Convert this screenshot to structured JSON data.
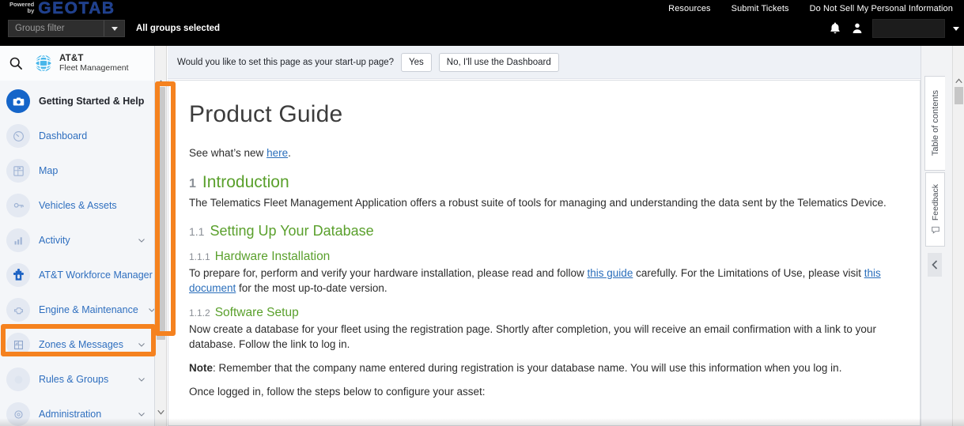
{
  "topbar": {
    "brand_powered": "Powered",
    "brand_by": "by",
    "brand_name": "GEOTAB",
    "groups_filter_placeholder": "Groups filter",
    "groups_selected": "All groups selected",
    "links": [
      {
        "label": "Resources"
      },
      {
        "label": "Submit Tickets"
      },
      {
        "label": "Do Not Sell My Personal Information"
      }
    ],
    "notifications_icon": "bell-icon",
    "user_icon": "person-icon",
    "user_name": "",
    "background_color": "#000000"
  },
  "sidebar": {
    "search_icon": "search-icon",
    "brand_line1": "AT&T",
    "brand_line2": "Fleet Management",
    "items": [
      {
        "label": "Getting Started & Help",
        "icon": "help-camera-icon",
        "expandable": true,
        "current": true,
        "style": "active"
      },
      {
        "label": "Dashboard",
        "icon": "gauge-icon",
        "expandable": false,
        "current": false,
        "style": "normal"
      },
      {
        "label": "Map",
        "icon": "map-grid-icon",
        "expandable": false,
        "current": false,
        "style": "normal"
      },
      {
        "label": "Vehicles & Assets",
        "icon": "vehicle-key-icon",
        "expandable": false,
        "current": false,
        "style": "normal"
      },
      {
        "label": "Activity",
        "icon": "bar-chart-icon",
        "expandable": true,
        "current": false,
        "style": "normal"
      },
      {
        "label": "AT&T Workforce Manager",
        "icon": "puzzle-icon",
        "expandable": false,
        "current": false,
        "style": "accent"
      },
      {
        "label": "Engine & Maintenance",
        "icon": "engine-icon",
        "expandable": true,
        "current": false,
        "style": "normal"
      },
      {
        "label": "Zones & Messages",
        "icon": "zone-icon",
        "expandable": true,
        "current": false,
        "style": "normal"
      },
      {
        "label": "Rules & Groups",
        "icon": "rules-icon",
        "expandable": true,
        "current": false,
        "style": "normal"
      },
      {
        "label": "Administration",
        "icon": "gear-icon",
        "expandable": true,
        "current": false,
        "style": "normal"
      }
    ]
  },
  "highlights": {
    "color": "#f5821f",
    "boxes": [
      {
        "name": "sidebar-scrollbar-highlight",
        "target": "sidebar scrollbar"
      },
      {
        "name": "zones-and-messages-highlight",
        "target": "Zones & Messages"
      }
    ]
  },
  "banner": {
    "question": "Would you like to set this page as your start-up page?",
    "yes_label": "Yes",
    "no_label": "No, I'll use the Dashboard"
  },
  "document": {
    "title": "Product Guide",
    "whats_new_prefix": "See what’s new ",
    "whats_new_link": "here",
    "whats_new_suffix": ".",
    "sections": {
      "intro_num": "1",
      "intro_title": "Introduction",
      "intro_body": "The Telematics Fleet Management Application offers a robust suite of tools for managing and understanding the data sent by the Telematics Device.",
      "db_num": "1.1",
      "db_title": "Setting Up Your Database",
      "hw_num": "1.1.1",
      "hw_title": "Hardware Installation",
      "hw_body_1": "To prepare for, perform and verify your hardware installation, please read and follow ",
      "hw_link_1": "this guide",
      "hw_body_2": " carefully. For the Limitations of Use, please visit ",
      "hw_link_2": "this document",
      "hw_body_3": " for the most up-to-date version.",
      "sw_num": "1.1.2",
      "sw_title": "Software Setup",
      "sw_body": "Now create a database for your fleet using the registration page. Shortly after completion, you will receive an email confirmation with a link to your database. Follow the link to log in.",
      "note_label": "Note",
      "note_body": ": Remember that the company name entered during registration is your database name. You will use this information when you log in.",
      "steps_intro": "Once logged in, follow the steps below to configure your asset:"
    }
  },
  "right_rail": {
    "toc_label": "Table of contents",
    "feedback_label": "Feedback",
    "feedback_icon": "speech-bubble-icon",
    "collapse_icon": "chevron-left-icon"
  }
}
